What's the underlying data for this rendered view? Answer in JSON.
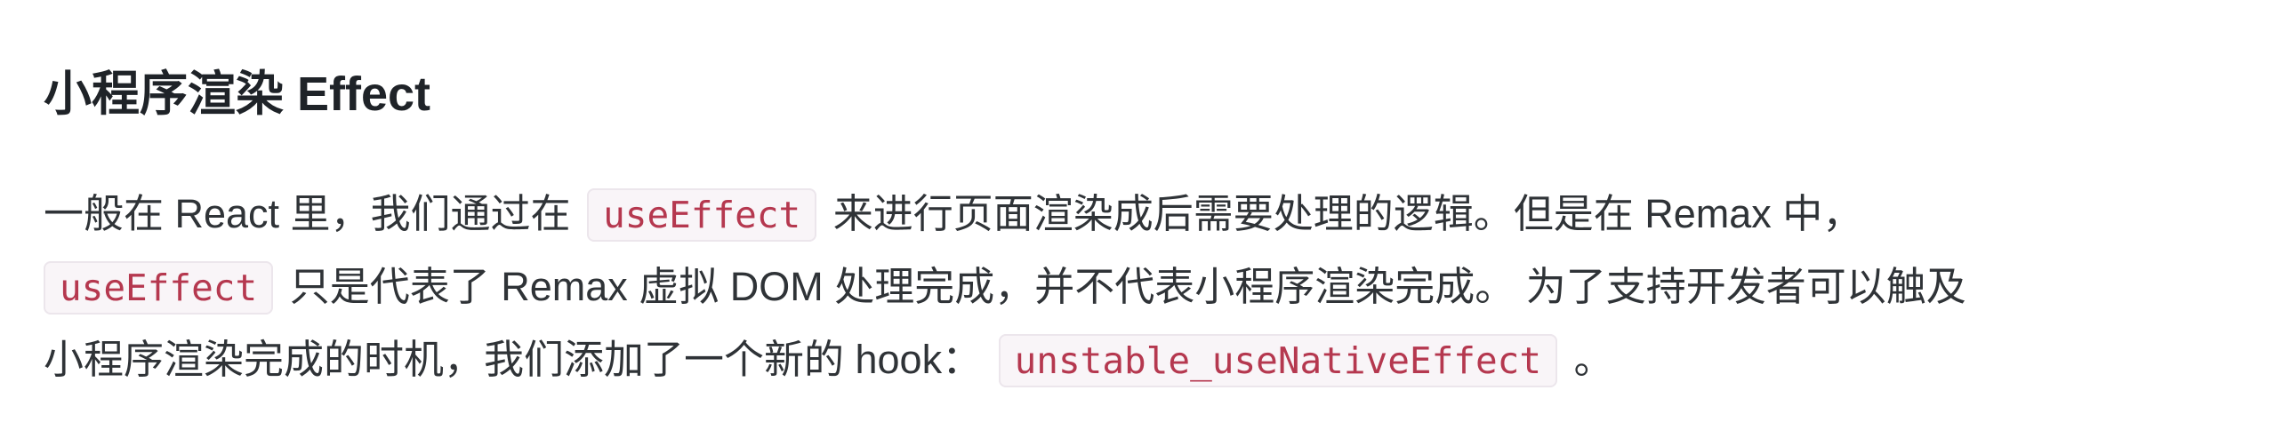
{
  "heading": "小程序渲染 Effect",
  "paragraph": {
    "line1": {
      "a": "一般在 React 里，我们通过在",
      "code": "useEffect",
      "b": "来进行页面渲染成后需要处理的逻辑。但是在 Remax 中，"
    },
    "line2": {
      "code": "useEffect",
      "b": "只是代表了 Remax 虚拟 DOM 处理完成，并不代表小程序渲染完成。 为了支持开发者可以触及"
    },
    "line3": {
      "a": "小程序渲染完成的时机，我们添加了一个新的 hook：",
      "code": "unstable_useNativeEffect",
      "b": "。"
    }
  },
  "colors": {
    "code_text": "#b5384f",
    "code_bg": "#f9f5f8",
    "text": "#2f3337"
  }
}
